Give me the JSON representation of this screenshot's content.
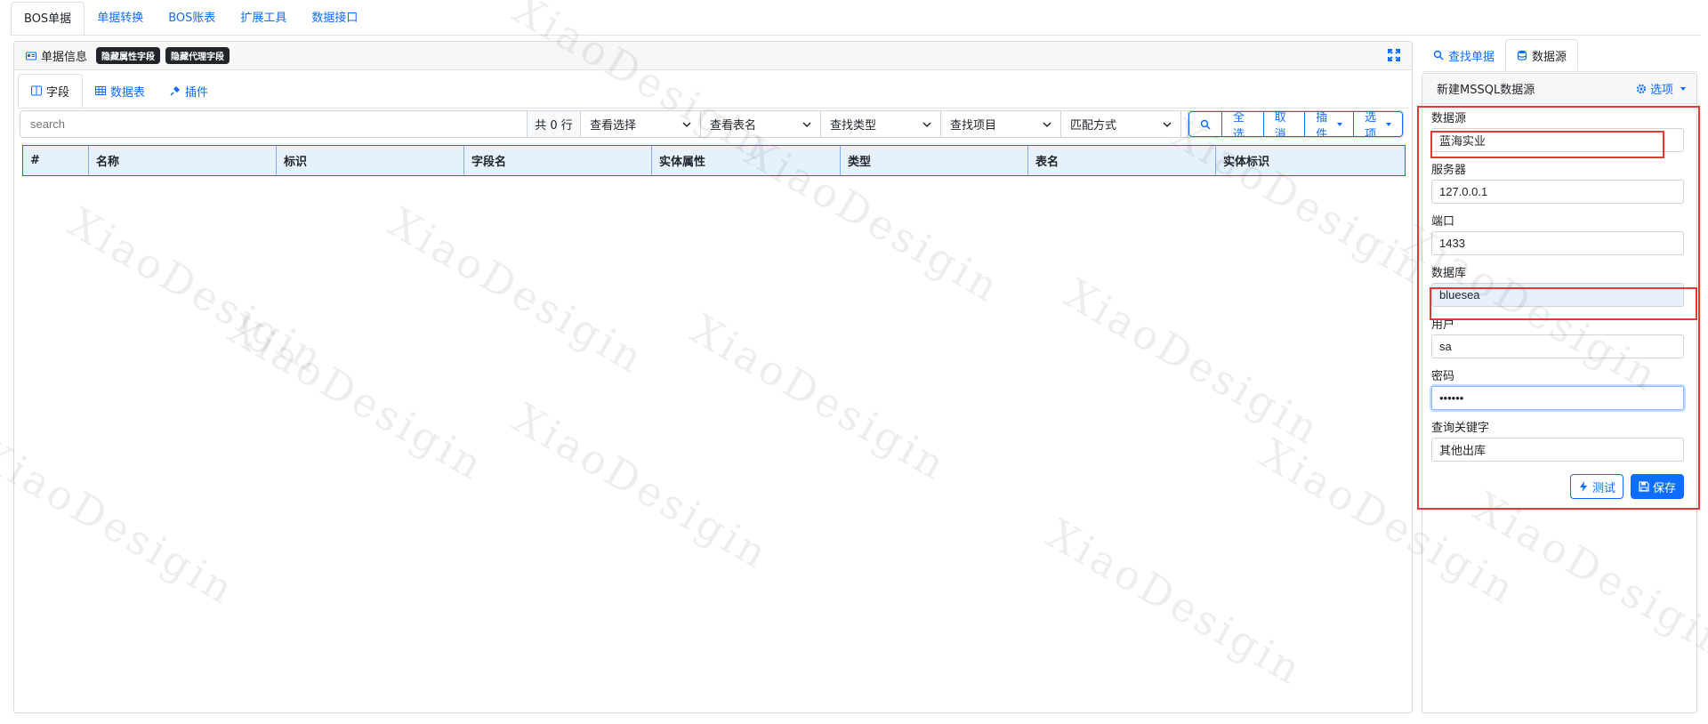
{
  "top_tabs": [
    "BOS单据",
    "单据转换",
    "BOS账表",
    "扩展工具",
    "数据接口"
  ],
  "bill_card": {
    "title": "单据信息",
    "badges": [
      "隐藏属性字段",
      "隐藏代理字段"
    ]
  },
  "sub_tabs": [
    "字段",
    "数据表",
    "插件"
  ],
  "toolbar": {
    "search_placeholder": "search",
    "row_count": "共 0 行",
    "selects": [
      "查看选择",
      "查看表名",
      "查找类型",
      "查找项目",
      "匹配方式"
    ],
    "select_all": "全选",
    "cancel": "取消",
    "plugin": "插件",
    "options": "选项"
  },
  "grid": {
    "columns": [
      "#",
      "名称",
      "标识",
      "字段名",
      "实体属性",
      "类型",
      "表名",
      "实体标识"
    ]
  },
  "right_tabs": [
    "查找单据",
    "数据源"
  ],
  "datasource": {
    "header_title": "新建MSSQL数据源",
    "header_option": "选项",
    "fields": [
      {
        "label": "数据源",
        "value": "蓝海实业"
      },
      {
        "label": "服务器",
        "value": "127.0.0.1"
      },
      {
        "label": "端口",
        "value": "1433"
      },
      {
        "label": "数据库",
        "value": "bluesea"
      },
      {
        "label": "用户",
        "value": "sa"
      },
      {
        "label": "密码",
        "value": "••••••"
      },
      {
        "label": "查询关键字",
        "value": "其他出库"
      }
    ],
    "test_label": "测试",
    "save_label": "保存"
  },
  "watermark": "XiaoDesigin",
  "colors": {
    "accent": "#0d6efd",
    "annotation": "#e53935"
  }
}
